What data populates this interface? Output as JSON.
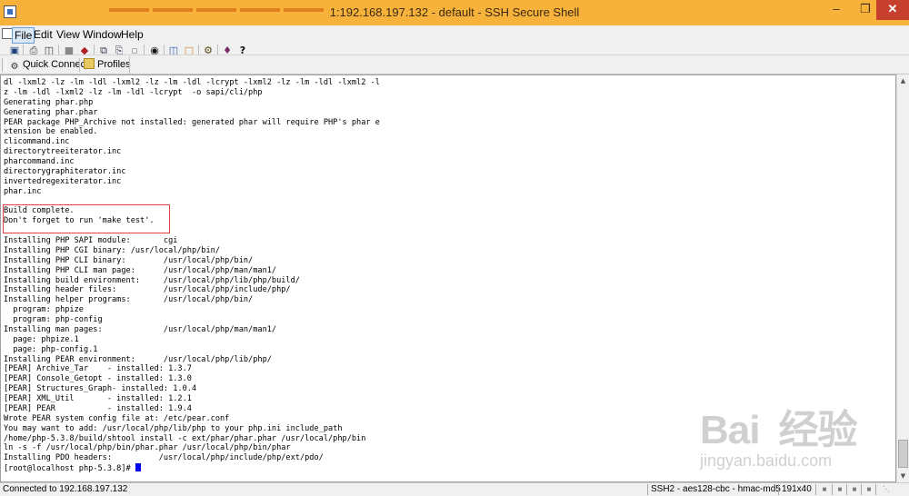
{
  "window": {
    "title": "1:192.168.197.132 - default - SSH Secure Shell",
    "minimize_label": "–",
    "maximize_label": "❐",
    "close_label": "✕"
  },
  "menu": {
    "file": "File",
    "edit": "Edit",
    "view": "View",
    "window": "Window",
    "help": "Help"
  },
  "toolbar": {
    "icons": [
      "save-icon",
      "print-icon",
      "print-preview-icon",
      "disconnect-icon",
      "connect-icon",
      "copy-icon",
      "paste-icon",
      "paste-special-icon",
      "find-icon",
      "file-transfer-icon",
      "new-terminal-icon",
      "settings-icon",
      "profile-icon",
      "help-icon"
    ]
  },
  "quickbar": {
    "quick_connect": "Quick Connect",
    "profiles": "Profiles"
  },
  "terminal": {
    "lines": [
      "dl -lxml2 -lz -lm -ldl -lxml2 -lz -lm -ldl -lcrypt -lxml2 -lz -lm -ldl -lxml2 -l",
      "z -lm -ldl -lxml2 -lz -lm -ldl -lcrypt  -o sapi/cli/php",
      "Generating phar.php",
      "Generating phar.phar",
      "PEAR package PHP_Archive not installed: generated phar will require PHP's phar e",
      "xtension be enabled.",
      "clicommand.inc",
      "directorytreeiterator.inc",
      "pharcommand.inc",
      "directorygraphiterator.inc",
      "invertedregexiterator.inc",
      "phar.inc",
      "",
      "Build complete.",
      "Don't forget to run 'make test'.",
      "",
      "Installing PHP SAPI module:       cgi",
      "Installing PHP CGI binary: /usr/local/php/bin/",
      "Installing PHP CLI binary:        /usr/local/php/bin/",
      "Installing PHP CLI man page:      /usr/local/php/man/man1/",
      "Installing build environment:     /usr/local/php/lib/php/build/",
      "Installing header files:          /usr/local/php/include/php/",
      "Installing helper programs:       /usr/local/php/bin/",
      "  program: phpize",
      "  program: php-config",
      "Installing man pages:             /usr/local/php/man/man1/",
      "  page: phpize.1",
      "  page: php-config.1",
      "Installing PEAR environment:      /usr/local/php/lib/php/",
      "[PEAR] Archive_Tar    - installed: 1.3.7",
      "[PEAR] Console_Getopt - installed: 1.3.0",
      "[PEAR] Structures_Graph- installed: 1.0.4",
      "[PEAR] XML_Util       - installed: 1.2.1",
      "[PEAR] PEAR           - installed: 1.9.4",
      "Wrote PEAR system config file at: /etc/pear.conf",
      "You may want to add: /usr/local/php/lib/php to your php.ini include_path",
      "/home/php-5.3.8/build/shtool install -c ext/phar/phar.phar /usr/local/php/bin",
      "ln -s -f /usr/local/php/bin/phar.phar /usr/local/php/bin/phar",
      "Installing PDO headers:          /usr/local/php/include/php/ext/pdo/"
    ],
    "prompt": "[root@localhost php-5.3.8]# "
  },
  "statusbar": {
    "connected": "Connected to 192.168.197.132",
    "cipher": "SSH2 - aes128-cbc - hmac-md5",
    "size": "191x40"
  },
  "watermark": {
    "main": "Bai 经验",
    "sub": "jingyan.baidu.com"
  },
  "colors": {
    "titlebar": "#f7b23b",
    "terminal_bg": "#ffffff",
    "cursor": "#0000ff",
    "highlight_border": "#e04040"
  }
}
